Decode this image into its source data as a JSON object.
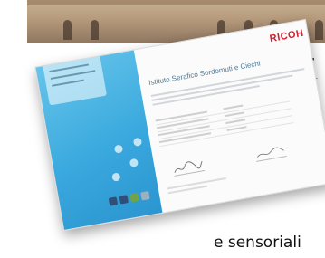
{
  "page": {
    "fragment_right_letter": "r",
    "fragment_right_tick": "t",
    "fragment_bottom_text": "e sensoriali"
  },
  "certificate": {
    "logo": "RICOH",
    "title": "Istituto Serafico Sordomuti e Ciechi"
  },
  "colors": {
    "card_blue": "#3aa9de",
    "logo_red": "#d1202f",
    "title_blue": "#4d7a96"
  }
}
